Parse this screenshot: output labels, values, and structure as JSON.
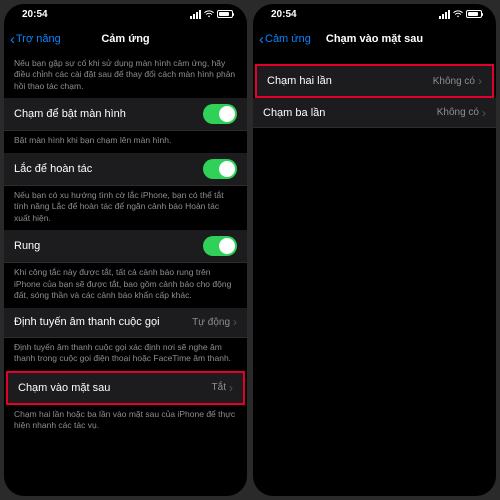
{
  "statusbar": {
    "time": "20:54"
  },
  "left": {
    "back": "Trợ năng",
    "title": "Cảm ứng",
    "intro": "Nếu bạn gặp sự cố khi sử dụng màn hình cảm ứng, hãy điều chỉnh các cài đặt sau để thay đổi cách màn hình phản hồi thao tác chạm.",
    "row_tap_wake": "Chạm để bật màn hình",
    "desc_tap_wake": "Bật màn hình khi bạn chạm lên màn hình.",
    "row_shake": "Lắc để hoàn tác",
    "desc_shake": "Nếu bạn có xu hướng tình cờ lắc iPhone, bạn có thể tắt tính năng Lắc để hoàn tác để ngăn cảnh báo Hoàn tác xuất hiện.",
    "row_vibe": "Rung",
    "desc_vibe": "Khi công tắc này được tắt, tất cả cảnh báo rung trên iPhone của bạn sẽ được tắt, bao gồm cảnh báo cho động đất, sóng thần và các cảnh báo khẩn cấp khác.",
    "row_audio": "Định tuyến âm thanh cuộc gọi",
    "val_audio": "Tự động",
    "desc_audio": "Định tuyến âm thanh cuộc gọi xác định nơi sẽ nghe âm thanh trong cuộc gọi điện thoại hoặc FaceTime âm thanh.",
    "row_backtap": "Chạm vào mặt sau",
    "val_backtap": "Tắt",
    "desc_backtap": "Chạm hai lần hoặc ba lần vào mặt sau của iPhone để thực hiện nhanh các tác vụ."
  },
  "right": {
    "back": "Cảm ứng",
    "title": "Chạm vào mặt sau",
    "row_double": "Chạm hai lần",
    "val_double": "Không có",
    "row_triple": "Chạm ba lần",
    "val_triple": "Không có"
  }
}
